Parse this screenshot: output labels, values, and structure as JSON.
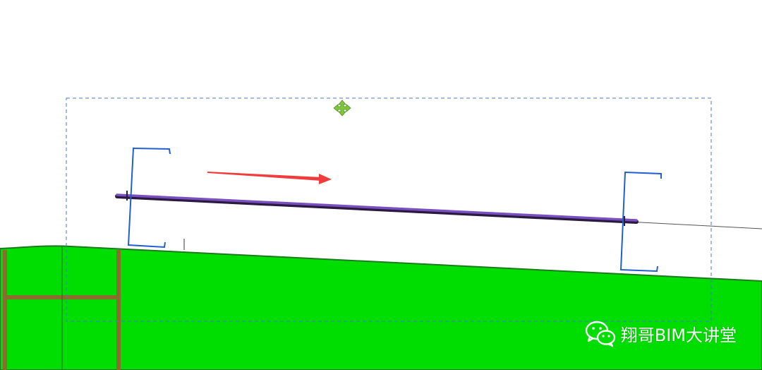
{
  "canvas": {
    "background": "#ffffff"
  },
  "terrain": {
    "fill_color": "#00dd00",
    "edge_color": "#1e7a1e"
  },
  "frame": {
    "color": "#8b6b2e"
  },
  "selection": {
    "border_color": "#4a78c8",
    "move_icon_color": "#7ec83a"
  },
  "beam": {
    "color": "#6a3fa0"
  },
  "pipe_brackets": {
    "color": "#1f5fd0"
  },
  "arrow": {
    "color": "#f03c3c"
  },
  "watermark": {
    "icon": "wechat-icon",
    "text": "翔哥BIM大讲堂"
  }
}
